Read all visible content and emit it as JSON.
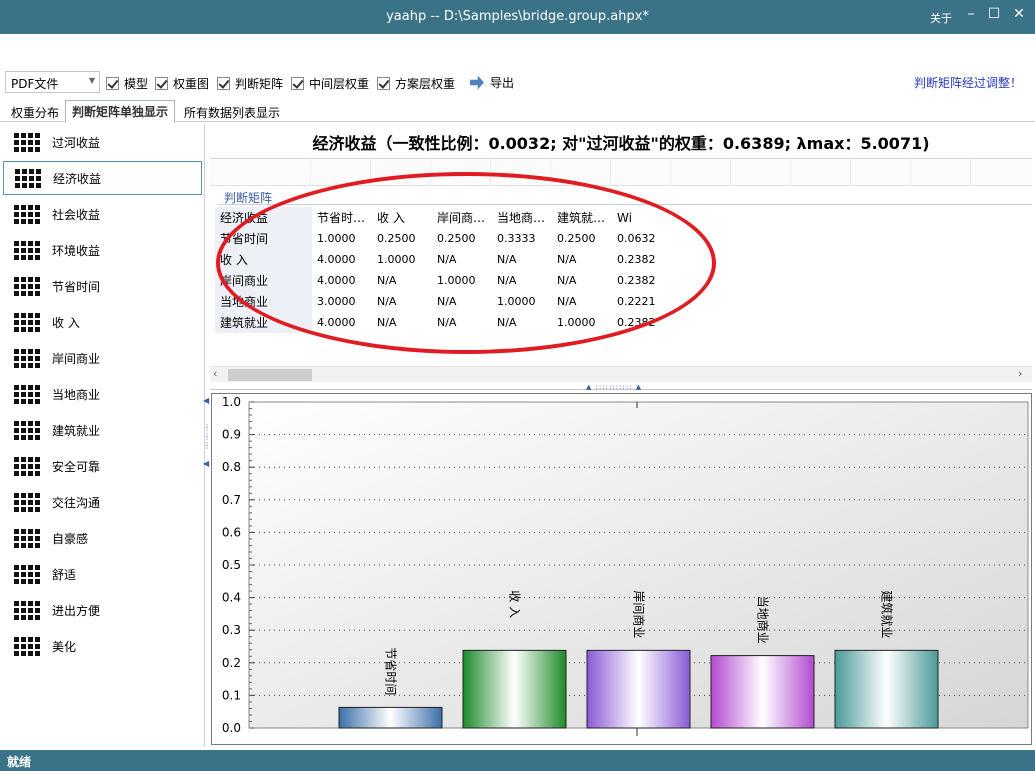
{
  "window": {
    "title": "yaahp -- D:\\Samples\\bridge.group.ahpx*",
    "about": "关于",
    "minimize": "–",
    "maximize": "☐",
    "close": "✕"
  },
  "toolbar": {
    "format_select": "PDF文件",
    "checkboxes": [
      "模型",
      "权重图",
      "判断矩阵",
      "中间层权重",
      "方案层权重"
    ],
    "export": "导出",
    "adjusted_link": "判断矩阵经过调整！"
  },
  "tabs": [
    "权重分布",
    "判断矩阵单独显示",
    "所有数据列表显示"
  ],
  "active_tab": 1,
  "sidebar": {
    "items": [
      "过河收益",
      "经济收益",
      "社会收益",
      "环境收益",
      "节省时间",
      "收 入",
      "岸间商业",
      "当地商业",
      "建筑就业",
      "安全可靠",
      "交往沟通",
      "自豪感",
      "舒适",
      "进出方便",
      "美化"
    ],
    "selected": 1
  },
  "main": {
    "heading": "经济收益（一致性比例：0.0032; 对\"过河收益\"的权重：0.6389; λmax：5.0071)",
    "matrix_label": "判断矩阵",
    "matrix": {
      "header": [
        "经济收益",
        "节省时…",
        "收 入",
        "岸间商…",
        "当地商…",
        "建筑就…",
        "Wi"
      ],
      "rows": [
        [
          "节省时间",
          "1.0000",
          "0.2500",
          "0.2500",
          "0.3333",
          "0.2500",
          "0.0632"
        ],
        [
          "收 入",
          "4.0000",
          "1.0000",
          "N/A",
          "N/A",
          "N/A",
          "0.2382"
        ],
        [
          "岸间商业",
          "4.0000",
          "N/A",
          "1.0000",
          "N/A",
          "N/A",
          "0.2382"
        ],
        [
          "当地商业",
          "3.0000",
          "N/A",
          "N/A",
          "1.0000",
          "N/A",
          "0.2221"
        ],
        [
          "建筑就业",
          "4.0000",
          "N/A",
          "N/A",
          "N/A",
          "1.0000",
          "0.2382"
        ]
      ]
    }
  },
  "chart_data": {
    "type": "bar",
    "categories": [
      "节省时间",
      "收 入",
      "岸间商业",
      "当地商业",
      "建筑就业"
    ],
    "values": [
      0.0632,
      0.2382,
      0.2382,
      0.2221,
      0.2382
    ],
    "ylim": [
      0,
      1.0
    ],
    "yticks": [
      "0.0",
      "0.1",
      "0.2",
      "0.3",
      "0.4",
      "0.5",
      "0.6",
      "0.7",
      "0.8",
      "0.9",
      "1.0"
    ],
    "grid": true,
    "bar_colors": [
      "#3b6fa8",
      "#1e8a2a",
      "#8a5ad6",
      "#b24ad0",
      "#4a9a98"
    ]
  },
  "statusbar": {
    "text": "就绪"
  }
}
